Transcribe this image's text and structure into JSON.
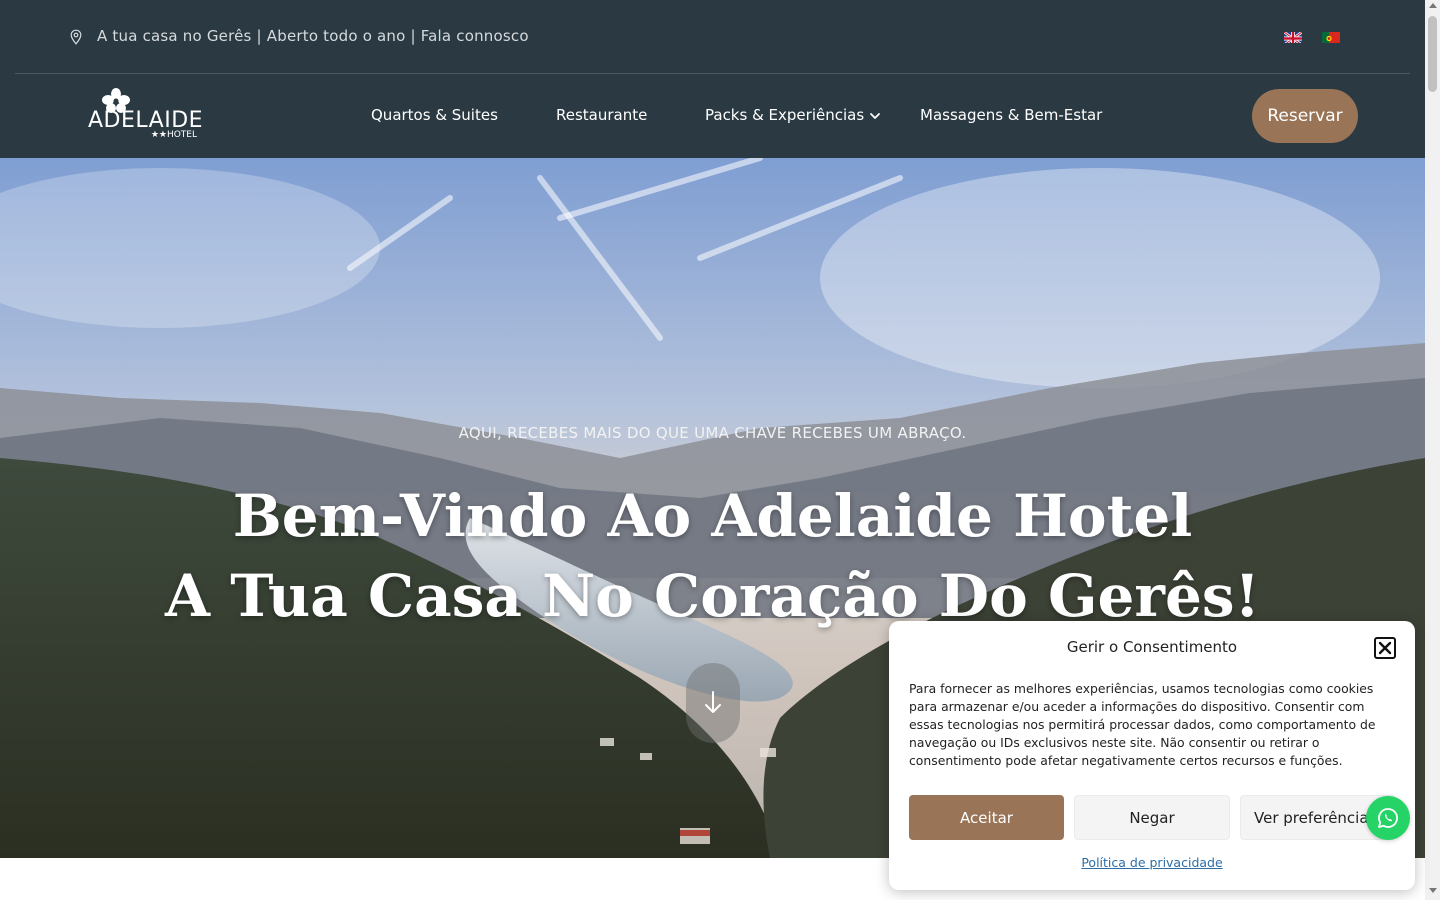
{
  "topbar": {
    "text": "A tua casa no Gerês | Aberto todo o ano | Fala connosco",
    "location_icon": "map-pin-icon",
    "languages": [
      "flag-en-icon",
      "flag-pt-icon"
    ]
  },
  "logo": {
    "wordmark": "ADELAIDE",
    "subtitle": "★★HOTEL"
  },
  "nav": {
    "items": [
      {
        "label": "Quartos & Suites"
      },
      {
        "label": "Restaurante"
      },
      {
        "label": "Packs & Experiências"
      },
      {
        "label": "Massagens & Bem-Estar"
      }
    ],
    "dropdown_icon": "chevron-down-icon"
  },
  "header": {
    "reserve_label": "Reservar"
  },
  "hero": {
    "tagline": "AQUI, RECEBES MAIS DO QUE UMA CHAVE RECEBES UM ABRAÇO.",
    "title_line1": "Bem-Vindo Ao Adelaide Hotel",
    "title_line2": "A Tua Casa No Coração Do Gerês!",
    "scroll_icon": "arrow-down-icon"
  },
  "cookie": {
    "title": "Gerir o Consentimento",
    "body": "Para fornecer as melhores experiências, usamos tecnologias como cookies para armazenar e/ou aceder a informações do dispositivo. Consentir com essas tecnologias nos permitirá processar dados, como comportamento de navegação ou IDs exclusivos neste site. Não consentir ou retirar o consentimento pode afetar negativamente certos recursos e funções.",
    "accept_label": "Aceitar",
    "deny_label": "Negar",
    "prefs_label": "Ver preferências",
    "privacy_link": "Política de privacidade",
    "close_icon": "close-icon"
  },
  "colors": {
    "header_bg": "#2a3942",
    "accent": "#9a7456",
    "whatsapp": "#25d366"
  }
}
